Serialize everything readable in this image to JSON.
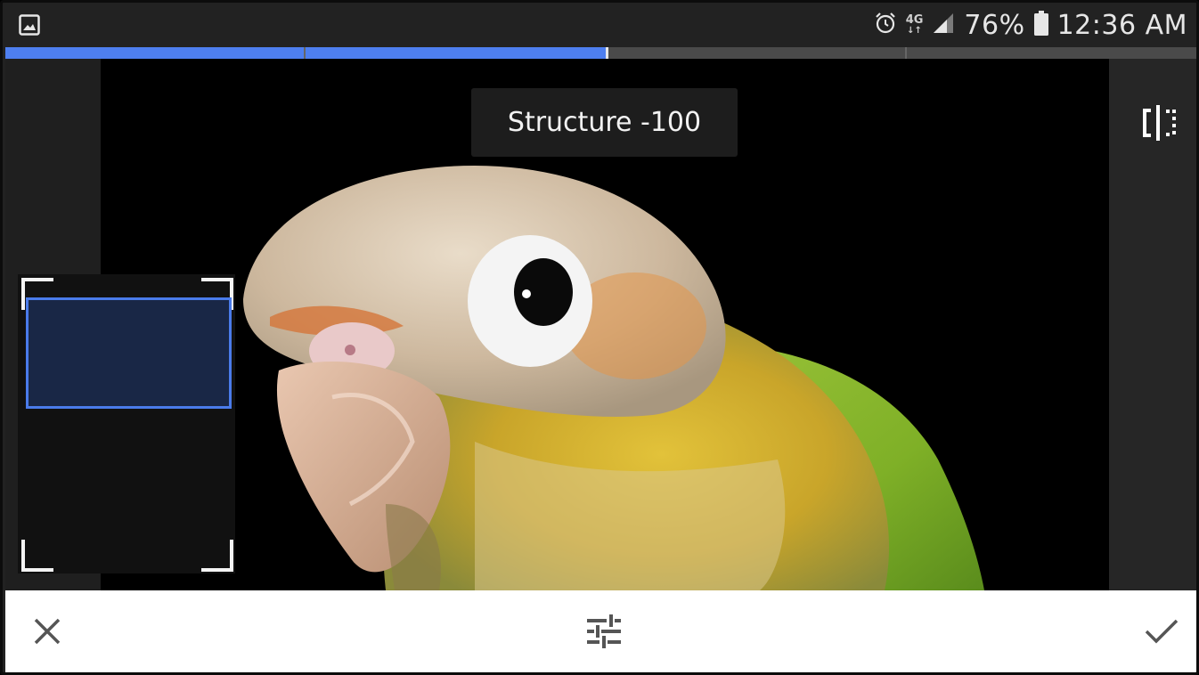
{
  "status_bar": {
    "gallery_icon": "image-icon",
    "alarm_icon": "alarm-clock-icon",
    "network_label": "4G",
    "signal_icon": "signal-strength-icon",
    "battery_percent": "76%",
    "battery_icon": "battery-icon",
    "time": "12:36 AM"
  },
  "adjustment": {
    "label": "Structure -100",
    "slider_fill_fraction": 0.503
  },
  "toolbar": {
    "cancel_icon": "close-icon",
    "tune_icon": "sliders-tune-icon",
    "apply_icon": "checkmark-icon"
  },
  "compare_icon": "compare-split-icon",
  "colors": {
    "accent": "#4e7ff0",
    "status_bar_bg": "#222222",
    "toolbar_bg": "#ffffff",
    "toolbar_icon": "#555555"
  }
}
